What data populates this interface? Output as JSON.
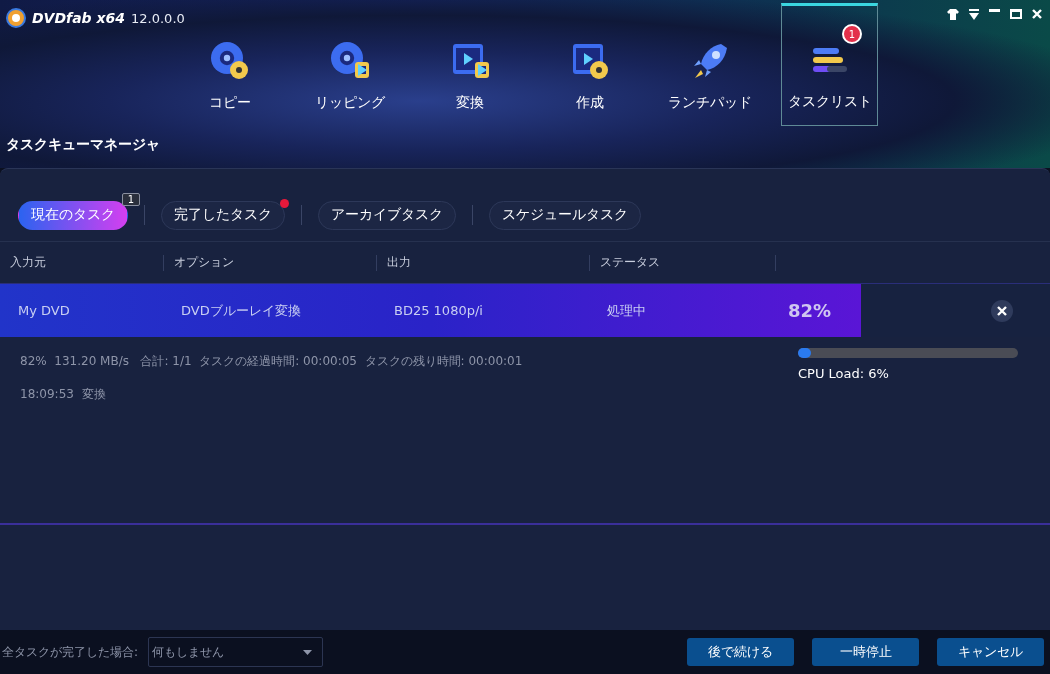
{
  "app": {
    "brand": "DVDfab x64",
    "version": "12.0.0.0"
  },
  "nav": [
    {
      "label": "コピー",
      "selected": false
    },
    {
      "label": "リッピング",
      "selected": false
    },
    {
      "label": "変換",
      "selected": false
    },
    {
      "label": "作成",
      "selected": false
    },
    {
      "label": "ランチパッド",
      "selected": false
    },
    {
      "label": "タスクリスト",
      "selected": true,
      "badge": "1"
    }
  ],
  "section_title": "タスクキューマネージャ",
  "tabs": [
    {
      "label": "現在のタスク",
      "selected": true,
      "badge": "1",
      "dot": false
    },
    {
      "label": "完了したタスク",
      "selected": false,
      "dot": true
    },
    {
      "label": "アーカイブタスク",
      "selected": false,
      "dot": false
    },
    {
      "label": "スケジュールタスク",
      "selected": false,
      "dot": false
    }
  ],
  "table": {
    "columns": [
      "入力元",
      "オプション",
      "出力",
      "ステータス"
    ],
    "rows": [
      {
        "cells": [
          "My DVD",
          "DVDブルーレイ変換",
          "BD25 1080p/i",
          "処理中"
        ],
        "level": 0.82,
        "reading": "82%"
      }
    ]
  },
  "details": {
    "stats": "82%  131.20 MB/s   合計: 1/1  タスクの経過時間: 00:00:05  タスクの残り時間: 00:00:01",
    "log": "18:09:53  変換",
    "cpu": {
      "level": 0.06,
      "label": "CPU Load: 6%"
    }
  },
  "footer": {
    "label": "全タスクが完了した場合:",
    "dropdown": "何もしません",
    "buttons": [
      "後で続ける",
      "一時停止",
      "キャンセル"
    ]
  }
}
